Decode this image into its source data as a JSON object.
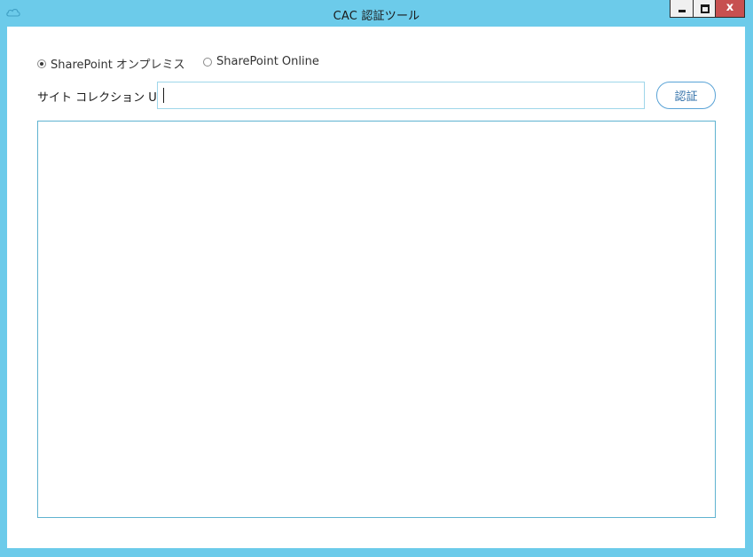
{
  "window": {
    "title": "CAC 認証ツール",
    "close_glyph": "x",
    "icons": {
      "app": "cloud-icon"
    },
    "colors": {
      "frame": "#6ccbea",
      "close": "#c75050",
      "accent": "#5aa3d6"
    }
  },
  "form": {
    "radio_onprem": {
      "label": "SharePoint オンプレミス",
      "checked": true
    },
    "radio_online": {
      "label": "SharePoint Online",
      "checked": false
    },
    "url_label": "サイト コレクション URL",
    "url_value": "",
    "auth_button": "認証"
  },
  "output": {
    "text": ""
  }
}
